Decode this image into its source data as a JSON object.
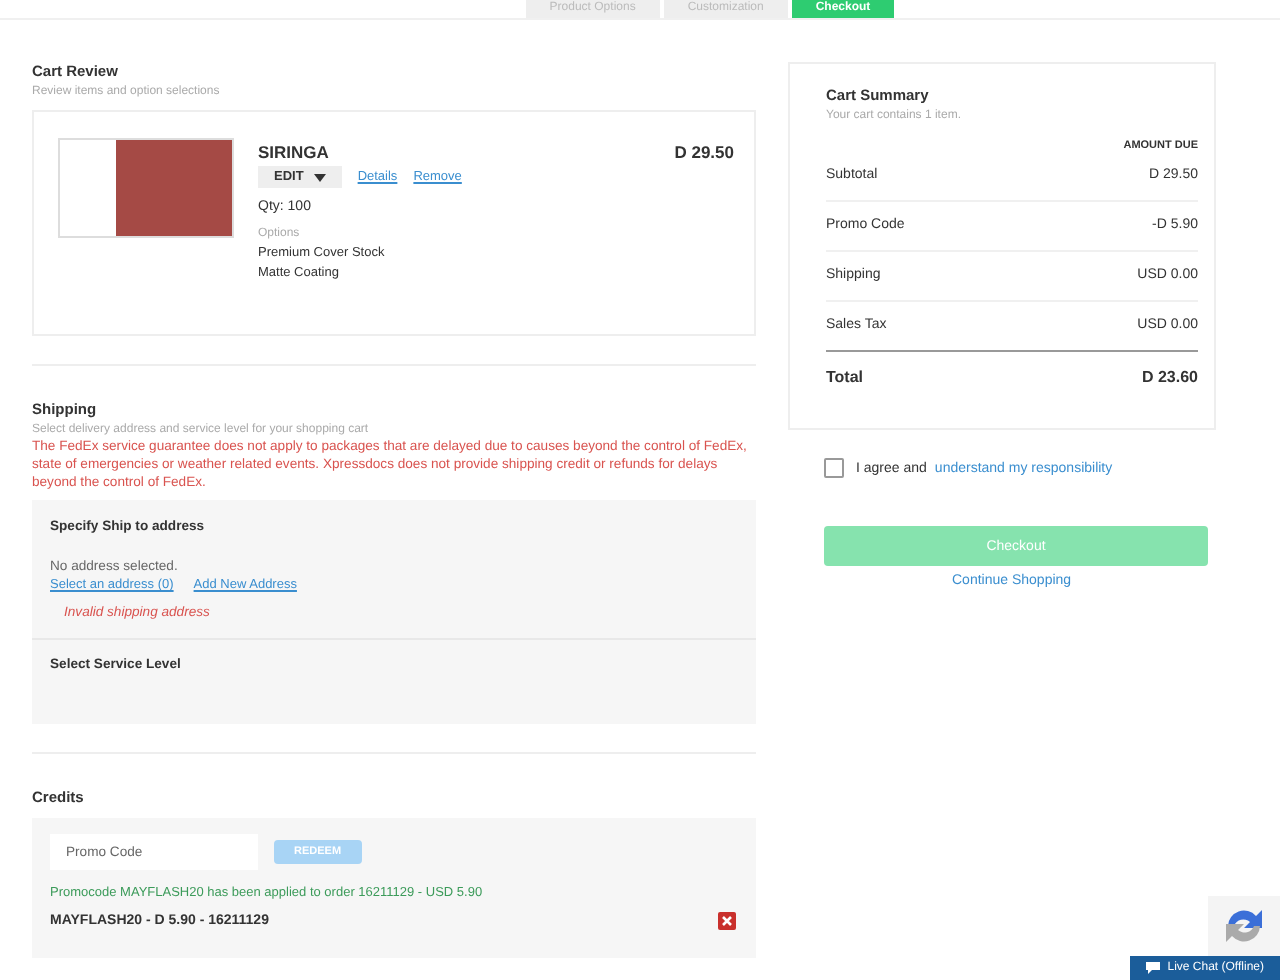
{
  "steps": [
    {
      "label": "Product Options",
      "selected": false
    },
    {
      "label": "Customization",
      "selected": false
    },
    {
      "label": "Checkout",
      "selected": true
    }
  ],
  "cart_review": {
    "title": "Cart Review",
    "subtitle": "Review items and option selections",
    "item": {
      "name": "SIRINGA",
      "edit": "EDIT",
      "details": "Details",
      "remove": "Remove",
      "qty": "Qty: 100",
      "options_label": "Options",
      "options": [
        "Premium Cover Stock",
        "Matte Coating"
      ],
      "price": "D 29.50"
    }
  },
  "shipping": {
    "title": "Shipping",
    "subtitle": "Select delivery address and service level for your shopping cart",
    "warning": "The FedEx service guarantee does not apply to packages that are delayed due to causes beyond the control of FedEx, state of emergencies or weather related events. Xpressdocs does not provide shipping credit or refunds for delays beyond the control of FedEx.",
    "address_title": "Specify Ship to address",
    "no_address": "No address selected.",
    "select_link": "Select an address (0)",
    "add_link": "Add New Address",
    "error": "Invalid shipping address",
    "service_title": "Select Service Level"
  },
  "credits": {
    "title": "Credits",
    "promo_field": {
      "placeholder": "Promo Code"
    },
    "redeem": {
      "label": "REDEEM",
      "disabled": true
    },
    "success": "Promocode MAYFLASH20 has been applied to order 16211129 - USD 5.90",
    "applied": "MAYFLASH20 - D 5.90 - 16211129"
  },
  "summary": {
    "title": "Cart Summary",
    "subtitle": "Your cart contains 1 item.",
    "column": "AMOUNT DUE",
    "rows": [
      {
        "label": "Subtotal",
        "value": "D 29.50",
        "kind": "line"
      },
      {
        "label": "Promo Code",
        "value": "-D 5.90",
        "kind": "line"
      },
      {
        "label": "Shipping",
        "value": "USD 0.00",
        "kind": "line"
      },
      {
        "label": "Sales Tax",
        "value": "USD 0.00",
        "kind": "line"
      },
      {
        "label": "Total",
        "value": "D 23.60",
        "kind": "total"
      }
    ]
  },
  "agree": {
    "text": "I agree and",
    "link": "understand my responsibility",
    "checked": false
  },
  "checkout": {
    "label": "Checkout",
    "disabled": true
  },
  "continue": "Continue Shopping",
  "live_chat": "Live Chat (Offline)"
}
